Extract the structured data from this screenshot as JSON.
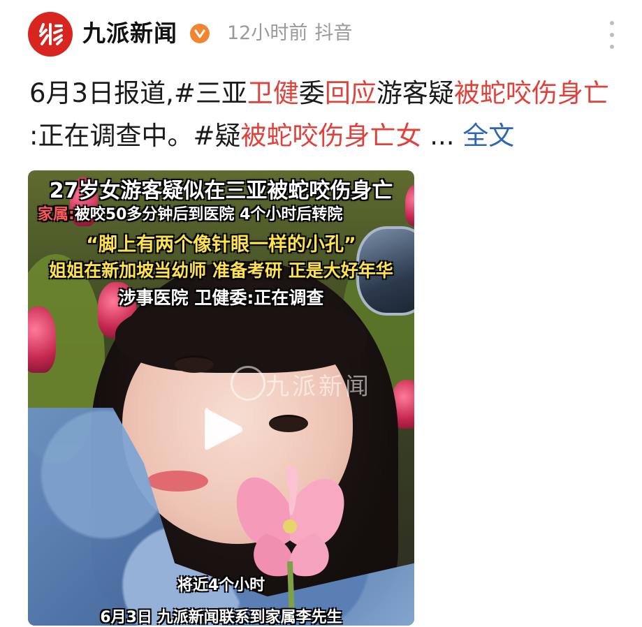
{
  "header": {
    "account_name": "九派新闻",
    "avatar_icon": "jiupai-logo-icon",
    "verified_icon": "verified-badge-icon",
    "time_ago": "12小时前",
    "source": "抖音",
    "more_icon": "more-vertical-icon"
  },
  "post": {
    "segments": [
      {
        "text": "6月3日报道,#三亚",
        "highlight": false
      },
      {
        "text": "卫健",
        "highlight": true
      },
      {
        "text": "委",
        "highlight": false
      },
      {
        "text": "回应",
        "highlight": true
      },
      {
        "text": "游客疑",
        "highlight": false
      },
      {
        "text": "被蛇咬伤身亡",
        "highlight": true
      },
      {
        "text": " :正在调查中。#疑",
        "highlight": false
      },
      {
        "text": "被蛇咬伤身亡女",
        "highlight": true
      },
      {
        "text": " ...",
        "highlight": false
      }
    ],
    "full_text_link": "全文"
  },
  "video": {
    "overlay_title": "27岁女游客疑似在三亚被蛇咬伤身亡",
    "family_label": "家属:",
    "family_text": "被咬50多分钟后到医院 4个小时后转院",
    "quote": "“脚上有两个像针眼一样的小孔”",
    "sister_line": "姐姐在新加坡当幼师 准备考研 正是大好年华",
    "hospital_line": "涉事医院 卫健委:正在调查",
    "watermark": "九派新闻",
    "play_icon": "play-icon",
    "caption_1": "将近4个小时",
    "caption_2": "6月3日 九派新闻联系到家属李先生",
    "colors": {
      "highlight": "#e0423b",
      "link": "#2f66b3",
      "overlay_yellow": "#ffe34d",
      "brand_red": "#d8251f"
    }
  }
}
